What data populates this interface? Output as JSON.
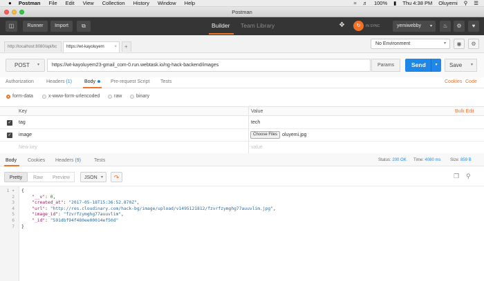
{
  "menubar": {
    "apple": "",
    "app": "Postman",
    "items": [
      "File",
      "Edit",
      "View",
      "Collection",
      "History",
      "Window",
      "Help"
    ],
    "battery": "100%",
    "clock": "Thu 4:38 PM",
    "user": "Oluyemi"
  },
  "window": {
    "title": "Postman"
  },
  "toolbar": {
    "runner": "Runner",
    "import": "Import",
    "tab_builder": "Builder",
    "tab_team_library": "Team Library",
    "sync": "IN SYNC",
    "user": "yemiwebby"
  },
  "tabs": [
    {
      "label": "http://localhost:8080/api/bc"
    },
    {
      "label": "https://wt-kayoluyem"
    }
  ],
  "environment": {
    "selected": "No Environment"
  },
  "request": {
    "method": "POST",
    "url": "https://wt-kayoluyem23-gmail_com-0.run.webtask.io/ng-hack-backend/images",
    "params_label": "Params",
    "send_label": "Send",
    "save_label": "Save"
  },
  "request_tabs": {
    "authorization": "Authorization",
    "headers": "Headers",
    "headers_count": "(1)",
    "body": "Body",
    "prerequest": "Pre-request Script",
    "tests": "Tests",
    "cookies": "Cookies",
    "code": "Code"
  },
  "body_types": {
    "form_data": "form-data",
    "urlencoded": "x-www-form-urlencoded",
    "raw": "raw",
    "binary": "binary"
  },
  "kv_table": {
    "key_header": "Key",
    "value_header": "Value",
    "bulk_edit": "Bulk Edit",
    "rows": [
      {
        "key": "tag",
        "value": "tech"
      },
      {
        "key": "image",
        "choose_files": "Choose Files",
        "value": "oluyemi.jpg"
      }
    ],
    "new_key_placeholder": "New key",
    "value_placeholder": "value"
  },
  "response": {
    "tab_body": "Body",
    "tab_cookies": "Cookies",
    "tab_headers": "Headers",
    "headers_count": "(9)",
    "tab_tests": "Tests",
    "status_label": "Status:",
    "status_value": "200 OK",
    "time_label": "Time:",
    "time_value": "4080 ms",
    "size_label": "Size:",
    "size_value": "859 B",
    "pretty": "Pretty",
    "raw": "Raw",
    "preview": "Preview",
    "format": "JSON",
    "code_lines": [
      {
        "num": "1",
        "text": "{"
      },
      {
        "num": "2",
        "key": "\"__v\"",
        "val": "0",
        "type": "n"
      },
      {
        "num": "3",
        "key": "\"created_at\"",
        "val": "\"2017-05-18T15:36:52.870Z\"",
        "type": "s"
      },
      {
        "num": "4",
        "key": "\"url\"",
        "val": "\"http://res.cloudinary.com/hack-bg/image/upload/v1495121812/fzvrfzymghg77auuvlim.jpg\"",
        "type": "s"
      },
      {
        "num": "5",
        "key": "\"image_id\"",
        "val": "\"fzvrfzymghg77auuvlim\"",
        "type": "s"
      },
      {
        "num": "6",
        "key": "\"_id\"",
        "val": "\"591dbf94f480ee00014ef50d\"",
        "type": "s",
        "last": true
      },
      {
        "num": "7",
        "text": "}"
      }
    ]
  },
  "colors": {
    "accent": "#f47023",
    "send": "#1f87e6",
    "toolbar": "#353535",
    "status_ok": "#1f87e6"
  }
}
